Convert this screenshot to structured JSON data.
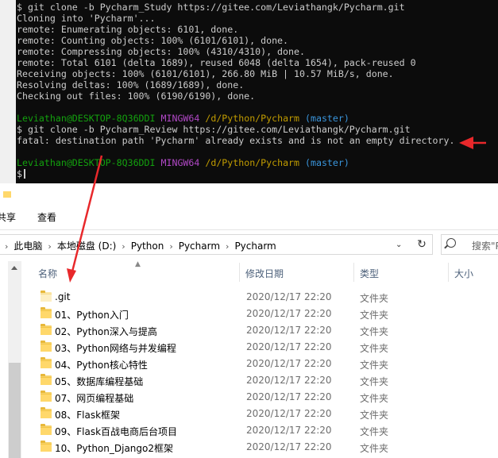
{
  "terminal": {
    "lines": [
      {
        "parts": [
          {
            "t": "$ git clone -b Pycharm_Study https://gitee.com/Leviathangk/Pycharm.git",
            "c": ""
          }
        ]
      },
      {
        "parts": [
          {
            "t": "Cloning into 'Pycharm'...",
            "c": ""
          }
        ]
      },
      {
        "parts": [
          {
            "t": "remote: Enumerating objects: 6101, done.",
            "c": ""
          }
        ]
      },
      {
        "parts": [
          {
            "t": "remote: Counting objects: 100% (6101/6101), done.",
            "c": ""
          }
        ]
      },
      {
        "parts": [
          {
            "t": "remote: Compressing objects: 100% (4310/4310), done.",
            "c": ""
          }
        ]
      },
      {
        "parts": [
          {
            "t": "remote: Total 6101 (delta 1689), reused 6048 (delta 1654), pack-reused 0",
            "c": ""
          }
        ]
      },
      {
        "parts": [
          {
            "t": "Receiving objects: 100% (6101/6101), 266.80 MiB | 10.57 MiB/s, done.",
            "c": ""
          }
        ]
      },
      {
        "parts": [
          {
            "t": "Resolving deltas: 100% (1689/1689), done.",
            "c": ""
          }
        ]
      },
      {
        "parts": [
          {
            "t": "Checking out files: 100% (6190/6190), done.",
            "c": ""
          }
        ]
      },
      {
        "parts": [
          {
            "t": "",
            "c": ""
          }
        ]
      },
      {
        "parts": [
          {
            "t": "Leviathan@DESKTOP-8Q36DDI",
            "c": "c-green"
          },
          {
            "t": " ",
            "c": ""
          },
          {
            "t": "MINGW64",
            "c": "c-magenta"
          },
          {
            "t": " ",
            "c": ""
          },
          {
            "t": "/d/Python/Pycharm",
            "c": "c-yellow"
          },
          {
            "t": " ",
            "c": ""
          },
          {
            "t": "(master)",
            "c": "c-cyan"
          }
        ]
      },
      {
        "parts": [
          {
            "t": "$ git clone -b Pycharm_Review https://gitee.com/Leviathangk/Pycharm.git",
            "c": ""
          }
        ]
      },
      {
        "parts": [
          {
            "t": "fatal: destination path 'Pycharm' already exists and is not an empty directory.",
            "c": ""
          }
        ]
      },
      {
        "parts": [
          {
            "t": "",
            "c": ""
          }
        ]
      },
      {
        "parts": [
          {
            "t": "Leviathan@DESKTOP-8Q36DDI",
            "c": "c-green"
          },
          {
            "t": " ",
            "c": ""
          },
          {
            "t": "MINGW64",
            "c": "c-magenta"
          },
          {
            "t": " ",
            "c": ""
          },
          {
            "t": "/d/Python/Pycharm",
            "c": "c-yellow"
          },
          {
            "t": " ",
            "c": ""
          },
          {
            "t": "(master)",
            "c": "c-cyan"
          }
        ]
      },
      {
        "parts": [
          {
            "t": "$",
            "c": ""
          }
        ],
        "cursor": true
      }
    ]
  },
  "ribbon": {
    "tab_share": "共享",
    "tab_view": "查看"
  },
  "address": {
    "crumbs": [
      "此电脑",
      "本地磁盘 (D:)",
      "Python",
      "Pycharm",
      "Pycharm"
    ],
    "search_placeholder": "搜索\"P"
  },
  "columns": {
    "name": "名称",
    "date": "修改日期",
    "type": "类型",
    "size": "大小"
  },
  "files": [
    {
      "name": ".git",
      "date": "2020/12/17 22:20",
      "type": "文件夹",
      "hidden": true
    },
    {
      "name": "01、Python入门",
      "date": "2020/12/17 22:20",
      "type": "文件夹"
    },
    {
      "name": "02、Python深入与提高",
      "date": "2020/12/17 22:20",
      "type": "文件夹"
    },
    {
      "name": "03、Python网络与并发编程",
      "date": "2020/12/17 22:20",
      "type": "文件夹"
    },
    {
      "name": "04、Python核心特性",
      "date": "2020/12/17 22:20",
      "type": "文件夹"
    },
    {
      "name": "05、数据库编程基础",
      "date": "2020/12/17 22:20",
      "type": "文件夹"
    },
    {
      "name": "07、网页编程基础",
      "date": "2020/12/17 22:20",
      "type": "文件夹"
    },
    {
      "name": "08、Flask框架",
      "date": "2020/12/17 22:20",
      "type": "文件夹"
    },
    {
      "name": "09、Flask百战电商后台项目",
      "date": "2020/12/17 22:20",
      "type": "文件夹"
    },
    {
      "name": "10、Python_Django2框架",
      "date": "2020/12/17 22:20",
      "type": "文件夹"
    }
  ],
  "colors": {
    "terminal_bg": "#0c0c0c",
    "terminal_fg": "#cccccc",
    "prompt_user": "#13a10e",
    "prompt_mingw": "#b148c6",
    "prompt_path": "#c19c00",
    "prompt_branch": "#3a96dd",
    "annotation_arrow": "#e8282b",
    "folder": "#ffd86b"
  }
}
